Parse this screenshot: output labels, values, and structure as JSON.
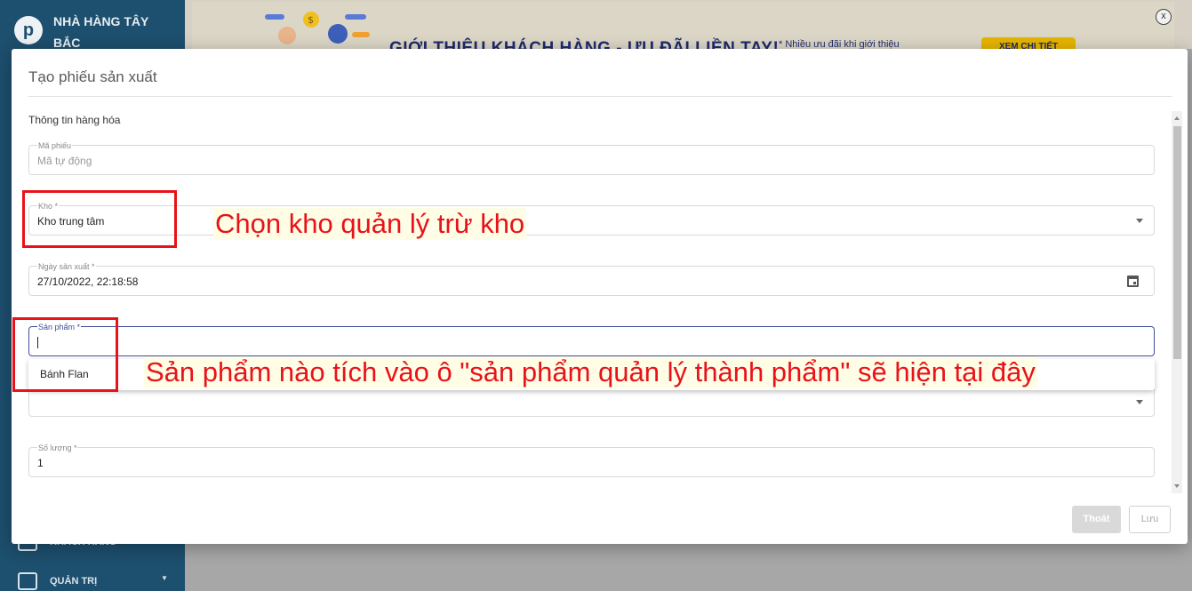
{
  "sidebar": {
    "logo_letter": "p",
    "brand_name": "NHÀ HÀNG TÂY BẮC",
    "items": [
      {
        "label": "KHÁCH HÀNG"
      },
      {
        "label": "QUẢN TRỊ"
      }
    ]
  },
  "banner": {
    "title": "GIỚI THIỆU KHÁCH HÀNG - ƯU ĐÃI LIỀN TAY!",
    "note": "* Nhiều ưu đãi khi giới thiệu",
    "button": "XEM CHI TIẾT",
    "close": "x"
  },
  "modal": {
    "title": "Tạo phiếu sản xuất",
    "section_label": "Thông tin hàng hóa",
    "fields": {
      "code": {
        "label": "Mã phiếu",
        "placeholder": "Mã tự động"
      },
      "warehouse": {
        "label": "Kho *",
        "value": "Kho trung tâm"
      },
      "date": {
        "label": "Ngày sản xuất *",
        "value": "27/10/2022, 22:18:58"
      },
      "product": {
        "label": "Sản phẩm *",
        "value": ""
      },
      "quantity": {
        "label": "Số lượng *",
        "value": "1"
      }
    },
    "dropdown_options": [
      "Bánh Flan"
    ],
    "buttons": {
      "exit": "Thoát",
      "save": "Lưu"
    }
  },
  "annotations": {
    "warehouse_note": "Chọn kho quản lý trừ kho",
    "product_note": "Sản phẩm nào tích vào ô \"sản phẩm quản lý thành phẩm\" sẽ hiện tại đây"
  },
  "colors": {
    "accent": "#3e4f9a",
    "sidebar": "#1d4f6e",
    "annotation": "#e8131a"
  }
}
